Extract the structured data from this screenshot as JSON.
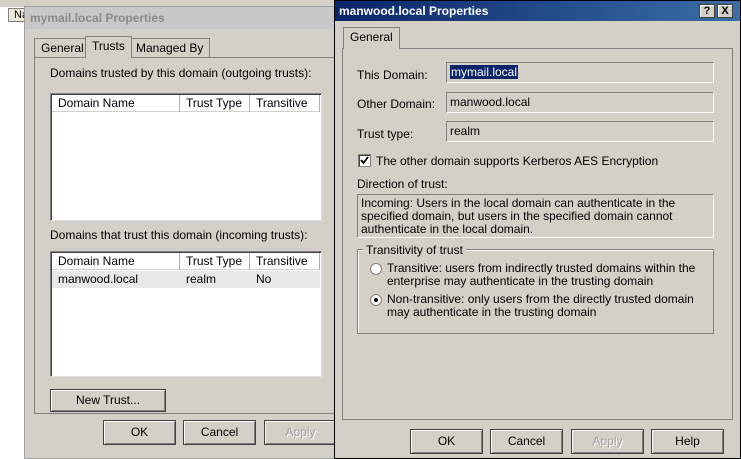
{
  "background_window": {
    "tab_label": "Na"
  },
  "window1": {
    "title": "mymail.local Properties",
    "tabs": [
      "General",
      "Trusts",
      "Managed By"
    ],
    "outgoing_label": "Domains trusted by this domain (outgoing trusts):",
    "incoming_label": "Domains that trust this domain (incoming trusts):",
    "columns": [
      "Domain Name",
      "Trust Type",
      "Transitive"
    ],
    "incoming_rows": [
      {
        "domain": "manwood.local",
        "type": "realm",
        "transitive": "No"
      }
    ],
    "new_trust_label": "New Trust...",
    "ok_label": "OK",
    "cancel_label": "Cancel",
    "apply_label": "Apply"
  },
  "window2": {
    "title": "manwood.local Properties",
    "help_button": "?",
    "close_button": "X",
    "tab": "General",
    "this_domain_label": "This Domain:",
    "this_domain_value": "mymail.local",
    "other_domain_label": "Other Domain:",
    "other_domain_value": "manwood.local",
    "trust_type_label": "Trust type:",
    "trust_type_value": "realm",
    "kerberos_label": "The other domain supports Kerberos AES Encryption",
    "kerberos_checked": true,
    "direction_label": "Direction of trust:",
    "direction_text": "Incoming: Users in the local domain can authenticate in the specified domain, but users in the specified domain cannot authenticate in the local domain.",
    "transitivity_label": "Transitivity of trust",
    "transitive_text": "Transitive: users from indirectly trusted domains within the enterprise may authenticate in the trusting domain",
    "nontransitive_text": "Non-transitive: only users from the directly trusted domain may authenticate in the trusting domain",
    "selected_option": "non-transitive",
    "ok_label": "OK",
    "cancel_label": "Cancel",
    "apply_label": "Apply",
    "help_label": "Help"
  }
}
